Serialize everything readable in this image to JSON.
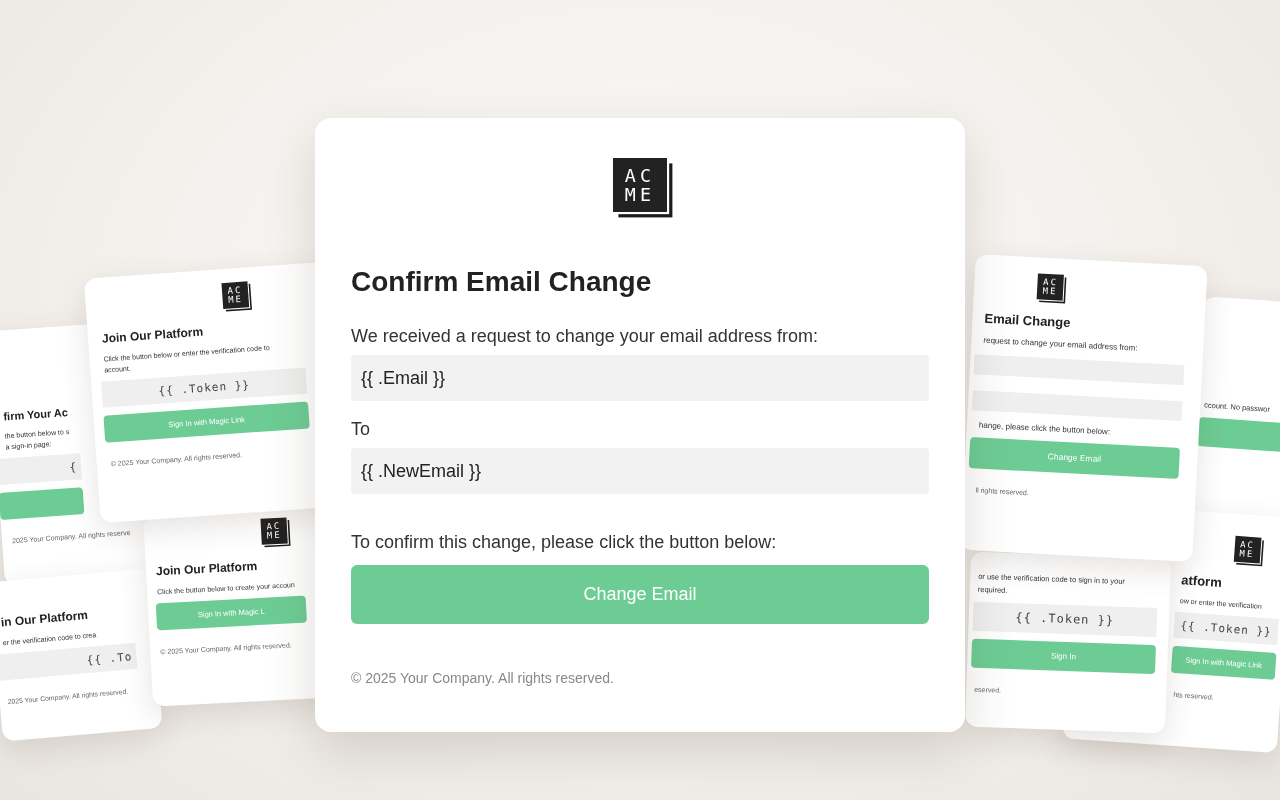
{
  "main_card": {
    "logo": [
      "AC",
      "ME"
    ],
    "title": "Confirm Email Change",
    "intro": "We received a request to change your email address from:",
    "current_email": "{{ .Email }}",
    "to_label": "To",
    "new_email": "{{ .NewEmail }}",
    "instruction": "To confirm this change, please click the button below:",
    "button": "Change Email",
    "footer": "© 2025 Your Company. All rights reserved."
  },
  "background_cards": [
    {
      "items": [
        {
          "kind": "title",
          "text": "firm Your Ac"
        },
        {
          "kind": "text",
          "text": "the button below to s"
        },
        {
          "kind": "text",
          "text": "a sign-in page:"
        },
        {
          "kind": "token",
          "text": "{"
        },
        {
          "kind": "button"
        },
        {
          "kind": "footer",
          "text": "2025 Your Company. All rights reserve"
        }
      ]
    },
    {
      "items": [
        {
          "kind": "logo",
          "logo": [
            "AC",
            "ME"
          ]
        },
        {
          "kind": "title",
          "text": "Join Our Platform"
        },
        {
          "kind": "text",
          "text": "Click the button below or enter the verification code to"
        },
        {
          "kind": "text",
          "text": "account."
        },
        {
          "kind": "token",
          "text": "{{ .Token }}"
        },
        {
          "kind": "button",
          "text": "Sign In with Magic Link"
        },
        {
          "kind": "footer",
          "text": "© 2025 Your Company. All rights reserved."
        }
      ]
    },
    {
      "items": [
        {
          "kind": "logo",
          "logo": [
            "AC",
            "ME"
          ]
        },
        {
          "kind": "title",
          "text": "Join Our Platform"
        },
        {
          "kind": "text",
          "text": "Click the button below to create your accoun"
        },
        {
          "kind": "button",
          "text": "Sign In with Magic L"
        },
        {
          "kind": "footer",
          "text": "© 2025 Your Company. All rights reserved."
        }
      ]
    },
    {
      "items": [
        {
          "kind": "title",
          "text": "in Our Platform"
        },
        {
          "kind": "text",
          "text": "er the verification code to crea"
        },
        {
          "kind": "token",
          "text": "{{ .To"
        },
        {
          "kind": "footer",
          "text": "2025 Your Company. All rights reserved."
        }
      ]
    },
    {
      "items": [
        {
          "kind": "logo",
          "logo": [
            "AC",
            "ME"
          ]
        },
        {
          "kind": "title",
          "text": "Email Change"
        },
        {
          "kind": "text",
          "text": "request to change your email address from:"
        },
        {
          "kind": "field"
        },
        {
          "kind": "field"
        },
        {
          "kind": "text",
          "text": "hange, please click the button below:"
        },
        {
          "kind": "button",
          "text": "Change Email"
        },
        {
          "kind": "footer",
          "text": "ll rights reserved."
        }
      ]
    },
    {
      "items": [
        {
          "kind": "text",
          "text": "ccount. No passwor"
        },
        {
          "kind": "button"
        }
      ]
    },
    {
      "items": [
        {
          "kind": "text",
          "text": "or use the verification code to sign in to your"
        },
        {
          "kind": "text",
          "text": "required."
        },
        {
          "kind": "token",
          "text": "{{ .Token }}"
        },
        {
          "kind": "button",
          "text": "Sign In"
        },
        {
          "kind": "footer",
          "text": "eserved."
        }
      ]
    },
    {
      "items": [
        {
          "kind": "logo",
          "logo": [
            "AC",
            "ME"
          ]
        },
        {
          "kind": "title",
          "text": "atform"
        },
        {
          "kind": "text",
          "text": "ow or enter the verification"
        },
        {
          "kind": "token",
          "text": "{{ .Token }}"
        },
        {
          "kind": "button",
          "text": "Sign In with Magic Link"
        },
        {
          "kind": "footer",
          "text": "hts reserved."
        }
      ]
    }
  ]
}
